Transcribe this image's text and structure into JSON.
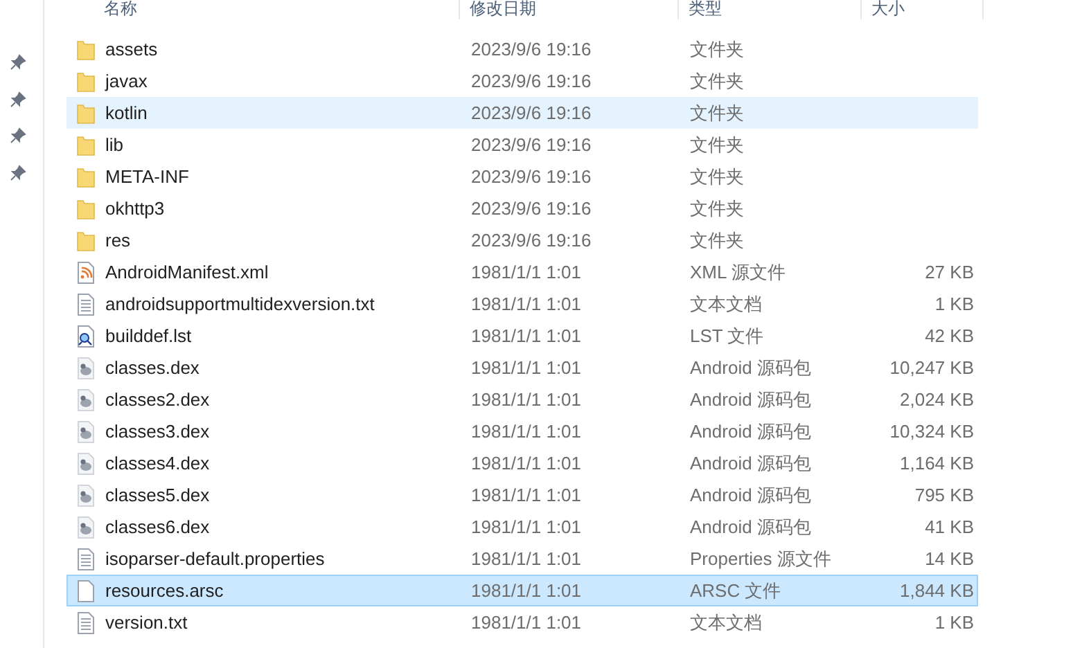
{
  "pins": [
    {
      "kind": "pin"
    },
    {
      "kind": "pin"
    },
    {
      "kind": "pin"
    },
    {
      "kind": "pin"
    }
  ],
  "columns": [
    "名称",
    "修改日期",
    "类型",
    "大小"
  ],
  "rows": [
    {
      "kind": "folder",
      "name": "assets",
      "date": "2023/9/6 19:16",
      "type": "文件夹",
      "selected": false,
      "hovered": false
    },
    {
      "kind": "folder",
      "name": "javax",
      "date": "2023/9/6 19:16",
      "type": "文件夹",
      "selected": false,
      "hovered": false
    },
    {
      "kind": "folder",
      "name": "kotlin",
      "date": "2023/9/6 19:16",
      "type": "文件夹",
      "selected": false,
      "hovered": true
    },
    {
      "kind": "folder",
      "name": "lib",
      "date": "2023/9/6 19:16",
      "type": "文件夹",
      "selected": false,
      "hovered": false
    },
    {
      "kind": "folder",
      "name": "META-INF",
      "date": "2023/9/6 19:16",
      "type": "文件夹",
      "selected": false,
      "hovered": false
    },
    {
      "kind": "folder",
      "name": "okhttp3",
      "date": "2023/9/6 19:16",
      "type": "文件夹",
      "selected": false,
      "hovered": false
    },
    {
      "kind": "folder",
      "name": "res",
      "date": "2023/9/6 19:16",
      "type": "文件夹",
      "selected": false,
      "hovered": false
    },
    {
      "kind": "xml",
      "name": "AndroidManifest.xml",
      "date": "1981/1/1 1:01",
      "type": "XML 源文件",
      "size": "27 KB",
      "selected": false,
      "hovered": false
    },
    {
      "kind": "text",
      "name": "androidsupportmultidexversion.txt",
      "date": "1981/1/1 1:01",
      "type": "文本文档",
      "size": "1 KB",
      "selected": false,
      "hovered": false
    },
    {
      "kind": "list",
      "name": "builddef.lst",
      "date": "1981/1/1 1:01",
      "type": "LST 文件",
      "size": "42 KB",
      "selected": false,
      "hovered": false
    },
    {
      "kind": "dex",
      "name": "classes.dex",
      "date": "1981/1/1 1:01",
      "type": "Android 源码包",
      "size": "10,247 KB",
      "selected": false,
      "hovered": false
    },
    {
      "kind": "dex",
      "name": "classes2.dex",
      "date": "1981/1/1 1:01",
      "type": "Android 源码包",
      "size": "2,024 KB",
      "selected": false,
      "hovered": false
    },
    {
      "kind": "dex",
      "name": "classes3.dex",
      "date": "1981/1/1 1:01",
      "type": "Android 源码包",
      "size": "10,324 KB",
      "selected": false,
      "hovered": false
    },
    {
      "kind": "dex",
      "name": "classes4.dex",
      "date": "1981/1/1 1:01",
      "type": "Android 源码包",
      "size": "1,164 KB",
      "selected": false,
      "hovered": false
    },
    {
      "kind": "dex",
      "name": "classes5.dex",
      "date": "1981/1/1 1:01",
      "type": "Android 源码包",
      "size": "795 KB",
      "selected": false,
      "hovered": false
    },
    {
      "kind": "dex",
      "name": "classes6.dex",
      "date": "1981/1/1 1:01",
      "type": "Android 源码包",
      "size": "41 KB",
      "selected": false,
      "hovered": false
    },
    {
      "kind": "text",
      "name": "isoparser-default.properties",
      "date": "1981/1/1 1:01",
      "type": "Properties 源文件",
      "size": "14 KB",
      "selected": false,
      "hovered": false
    },
    {
      "kind": "blank",
      "name": "resources.arsc",
      "date": "1981/1/1 1:01",
      "type": "ARSC 文件",
      "size": "1,844 KB",
      "selected": true,
      "hovered": false
    },
    {
      "kind": "text",
      "name": "version.txt",
      "date": "1981/1/1 1:01",
      "type": "文本文档",
      "size": "1 KB",
      "selected": false,
      "hovered": false
    }
  ]
}
